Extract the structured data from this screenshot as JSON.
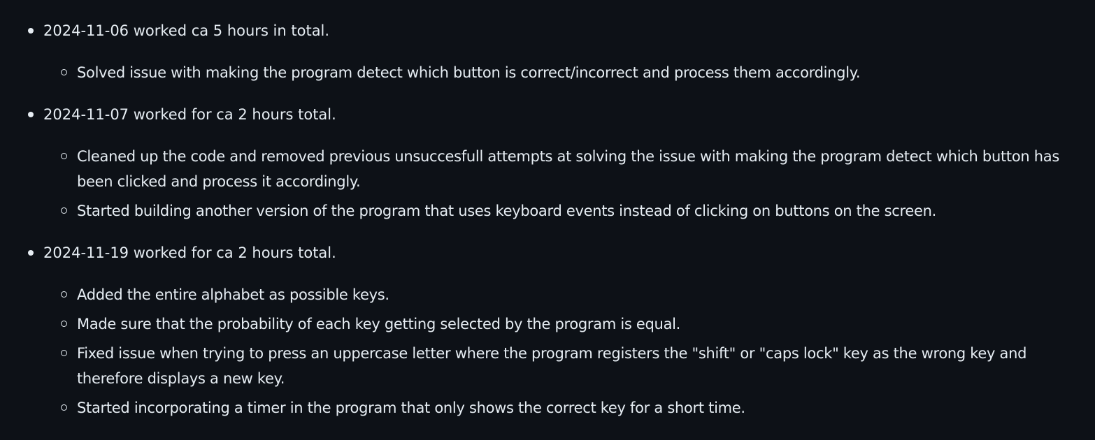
{
  "entries": [
    {
      "text": "2024-11-06 worked ca 5 hours in total.",
      "items": [
        "Solved issue with making the program detect which button is correct/incorrect and process them accordingly."
      ]
    },
    {
      "text": "2024-11-07 worked for ca 2 hours total.",
      "items": [
        "Cleaned up the code and removed previous unsuccesfull attempts at solving the issue with making the program detect which button has been clicked and process it accordingly.",
        "Started building another version of the program that uses keyboard events instead of clicking on buttons on the screen."
      ]
    },
    {
      "text": "2024-11-19 worked for ca 2 hours total.",
      "items": [
        "Added the entire alphabet as possible keys.",
        "Made sure that the probability of each key getting selected by the program is equal.",
        "Fixed issue when trying to press an uppercase letter where the program registers the \"shift\" or \"caps lock\" key as the wrong key and therefore displays a new key.",
        "Started incorporating a timer in the program that only shows the correct key for a short time."
      ]
    }
  ]
}
